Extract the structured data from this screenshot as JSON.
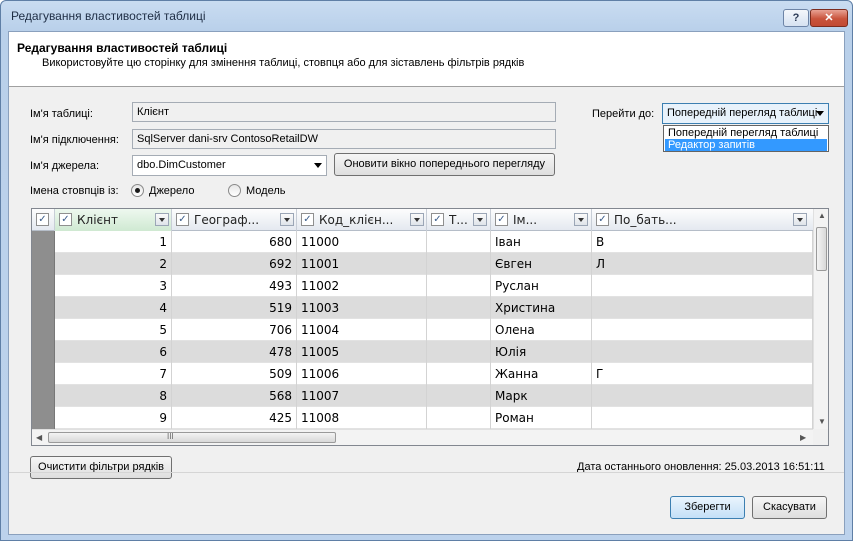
{
  "window": {
    "title": "Редагування властивостей таблиці",
    "help": "?",
    "close": "✕"
  },
  "header": {
    "title": "Редагування властивостей таблиці",
    "subtitle": "Використовуйте цю сторінку для змінення таблиці, стовпця або для зіставлень фільтрів рядків"
  },
  "form": {
    "table_name_label": "Ім'я таблиці:",
    "table_name_value": "Клієнт",
    "connection_label": "Ім'я підключення:",
    "connection_value": "SqlServer dani-srv ContosoRetailDW",
    "source_label": "Ім'я джерела:",
    "source_value": "dbo.DimCustomer",
    "refresh_button": "Оновити вікно попереднього перегляду",
    "column_names_label": "Імена стовпців із:",
    "radio_source": "Джерело",
    "radio_model": "Модель",
    "goto_label": "Перейти до:",
    "goto_value": "Попередній перегляд таблиці",
    "goto_options": [
      "Попередній перегляд таблиці",
      "Редактор запитів"
    ]
  },
  "grid": {
    "columns": [
      "Клієнт",
      "Географ...",
      "Код_клієн...",
      "Т...",
      "Ім...",
      "По_бать..."
    ],
    "rows": [
      [
        "1",
        "680",
        "11000",
        "",
        "Іван",
        "В"
      ],
      [
        "2",
        "692",
        "11001",
        "",
        "Євген",
        "Л"
      ],
      [
        "3",
        "493",
        "11002",
        "",
        "Руслан",
        ""
      ],
      [
        "4",
        "519",
        "11003",
        "",
        "Христина",
        ""
      ],
      [
        "5",
        "706",
        "11004",
        "",
        "Олена",
        ""
      ],
      [
        "6",
        "478",
        "11005",
        "",
        "Юлія",
        ""
      ],
      [
        "7",
        "509",
        "11006",
        "",
        "Жанна",
        "Г"
      ],
      [
        "8",
        "568",
        "11007",
        "",
        "Марк",
        ""
      ],
      [
        "9",
        "425",
        "11008",
        "",
        "Роман",
        ""
      ]
    ],
    "hscroll_grip": "III"
  },
  "footer": {
    "clear_filters_button": "Очистити фільтри рядків",
    "last_updated": "Дата останнього оновлення: 25.03.2013 16:51:11",
    "save_button": "Зберегти",
    "cancel_button": "Скасувати"
  }
}
